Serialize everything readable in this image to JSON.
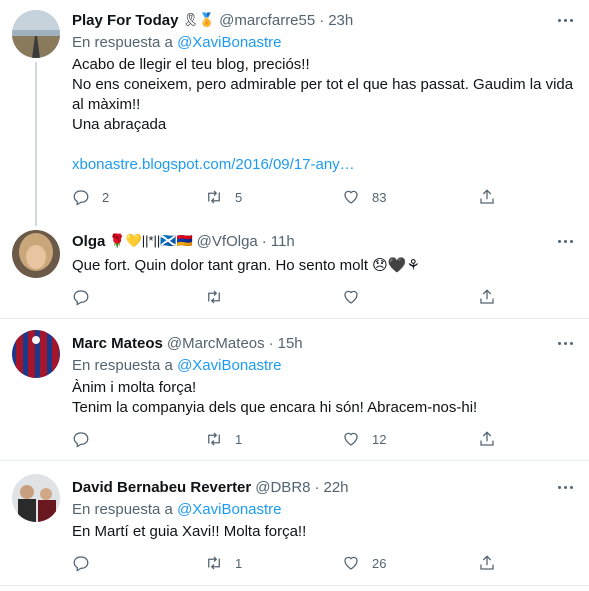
{
  "tweets": [
    {
      "name": "Play For Today",
      "name_emoji": "🎗🏅",
      "handle": "@marcfarre55",
      "time": "23h",
      "reply_prefix": "En respuesta a",
      "reply_to": "@XaviBonastre",
      "lines": [
        "Acabo de llegir el teu blog, preciós!!",
        "No ens coneixem, pero admirable per tot el que has passat. Gaudim la vida",
        "al màxim!!",
        "Una abraçada"
      ],
      "link": "xbonastre.blogspot.com/2016/09/17-any…",
      "replies": "2",
      "retweets": "5",
      "likes": "83",
      "avatar_color": "#8a9aa8"
    },
    {
      "name": "Olga",
      "name_emoji": "🌹💛||*||🏴󠁧󠁢󠁳󠁣󠁴󠁿🇦🇲",
      "handle": "@VfOlga",
      "time": "11h",
      "lines": [
        "Que fort. Quin dolor tant gran. Ho sento molt 😞🖤⚘"
      ],
      "replies": "",
      "retweets": "",
      "likes": "",
      "avatar_color": "#b59a7a"
    },
    {
      "name": "Marc Mateos",
      "handle": "@MarcMateos",
      "time": "15h",
      "reply_prefix": "En respuesta a",
      "reply_to": "@XaviBonastre",
      "lines": [
        "Ànim i molta força!",
        "Tenim la companyia dels que encara hi són! Abracem-nos-hi!"
      ],
      "replies": "",
      "retweets": "1",
      "likes": "12",
      "avatar_color": "#a3162b"
    },
    {
      "name": "David Bernabeu Reverter",
      "handle": "@DBR8",
      "time": "22h",
      "reply_prefix": "En respuesta a",
      "reply_to": "@XaviBonastre",
      "lines": [
        "En Martí et guia Xavi!! Molta força!!"
      ],
      "replies": "",
      "retweets": "1",
      "likes": "26",
      "avatar_color": "#4a4a4a"
    }
  ],
  "colors": {
    "accent": "#1d9bf0",
    "muted": "#536471",
    "separator": "#e6ecf0"
  },
  "icons": [
    "reply-icon",
    "retweet-icon",
    "like-icon",
    "share-icon",
    "more-icon"
  ]
}
